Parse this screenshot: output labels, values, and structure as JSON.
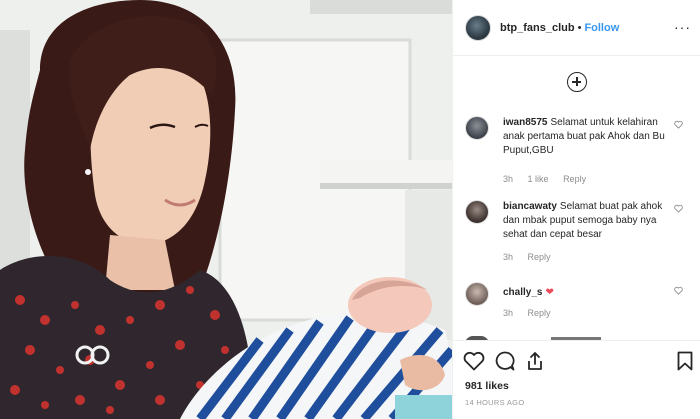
{
  "post": {
    "username": "btp_fans_club",
    "separator": "•",
    "follow_label": "Follow",
    "more_label": "···",
    "load_more_icon": "plus-circle-icon",
    "likes": "981 likes",
    "timestamp": "14 HOURS AGO"
  },
  "comments": [
    {
      "username": "iwan8575",
      "text": "Selamat untuk kelahiran anak pertama buat pak Ahok dan Bu Puput,GBU",
      "time": "3h",
      "likes": "1 like",
      "reply_label": "Reply"
    },
    {
      "username": "biancawaty",
      "text": "Selamat buat pak ahok dan mbak puput semoga baby nya sehat dan cepat besar",
      "time": "3h",
      "likes": "",
      "reply_label": "Reply"
    },
    {
      "username": "chally_s",
      "text": "",
      "emoji": "❤",
      "time": "3h",
      "likes": "",
      "reply_label": "Reply"
    }
  ],
  "colors": {
    "link_blue": "#3897f0",
    "muted": "#8e8e8e",
    "heart_red": "#ed4956"
  }
}
